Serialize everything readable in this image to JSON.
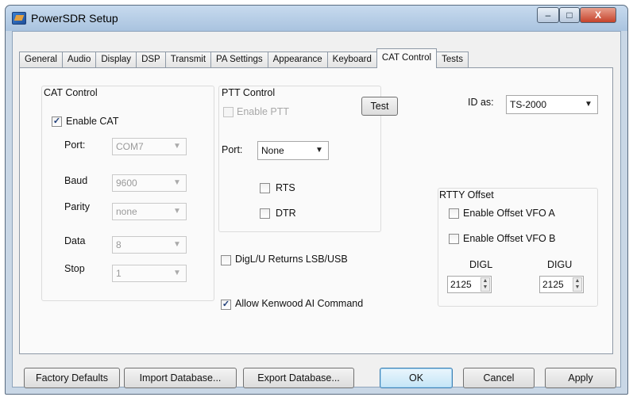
{
  "window": {
    "title": "PowerSDR Setup",
    "minimize": "–",
    "maximize": "□",
    "close": "X"
  },
  "tabs": [
    "General",
    "Audio",
    "Display",
    "DSP",
    "Transmit",
    "PA Settings",
    "Appearance",
    "Keyboard",
    "CAT Control",
    "Tests"
  ],
  "active_tab": "CAT Control",
  "cat_control": {
    "group_label": "CAT Control",
    "enable_label": "Enable CAT",
    "enable_checked": true,
    "port_label": "Port:",
    "port_value": "COM7",
    "baud_label": "Baud",
    "baud_value": "9600",
    "parity_label": "Parity",
    "parity_value": "none",
    "data_label": "Data",
    "data_value": "8",
    "stop_label": "Stop",
    "stop_value": "1"
  },
  "ptt_control": {
    "group_label": "PTT Control",
    "enable_label": "Enable PTT",
    "port_label": "Port:",
    "port_value": "None",
    "rts_label": "RTS",
    "dtr_label": "DTR"
  },
  "test_button": "Test",
  "id_as": {
    "label": "ID as:",
    "value": "TS-2000"
  },
  "digl_returns_label": "DigL/U Returns LSB/USB",
  "allow_kenwood_label": "Allow Kenwood AI Command",
  "allow_kenwood_checked": true,
  "rtty_offset": {
    "group_label": "RTTY Offset",
    "vfo_a_label": "Enable Offset VFO A",
    "vfo_b_label": "Enable Offset VFO B",
    "digl_label": "DIGL",
    "digl_value": "2125",
    "digu_label": "DIGU",
    "digu_value": "2125"
  },
  "buttons": {
    "factory_defaults": "Factory Defaults",
    "import_database": "Import Database...",
    "export_database": "Export Database...",
    "ok": "OK",
    "cancel": "Cancel",
    "apply": "Apply"
  }
}
